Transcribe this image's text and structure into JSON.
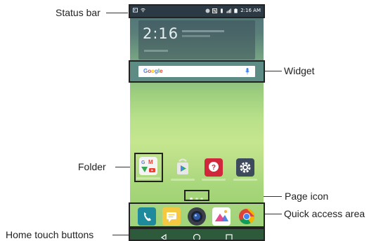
{
  "callouts": {
    "status_bar": "Status bar",
    "widget": "Widget",
    "folder": "Folder",
    "page_icon": "Page icon",
    "quick_access": "Quick access area",
    "home_touch": "Home touch buttons"
  },
  "status_bar": {
    "time": "2:16 AM"
  },
  "clock_widget": {
    "time": "2:16"
  },
  "search": {
    "brand": "Google"
  },
  "colors": {
    "google_blue": "#4285f4",
    "google_red": "#ea4335",
    "google_yellow": "#fbbc05",
    "google_green": "#34a853"
  },
  "icons": {
    "folder": "folder-icon",
    "play_store": "play-store-icon",
    "help": "help-icon",
    "settings": "gear-icon",
    "phone": "phone-icon",
    "messages": "messages-icon",
    "camera": "camera-icon",
    "gallery": "gallery-icon",
    "chrome": "chrome-icon"
  }
}
